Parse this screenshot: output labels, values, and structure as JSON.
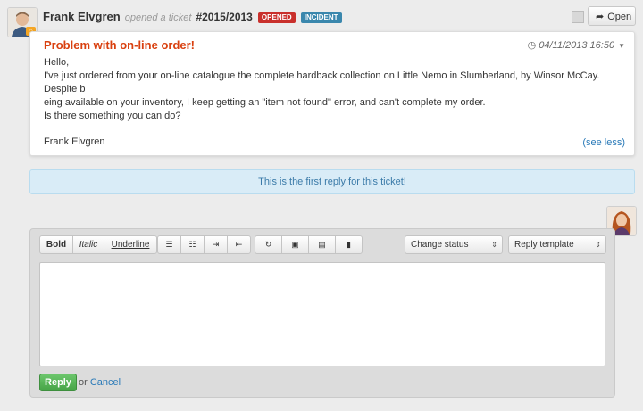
{
  "header": {
    "author": "Frank Elvgren",
    "action": "opened a ticket",
    "ticket_no": "#2015/2013",
    "badge_status": "OPENED",
    "badge_type": "INCIDENT",
    "open_label": "Open"
  },
  "message": {
    "subject": "Problem with on-line order!",
    "date": "04/11/2013 16:50",
    "body": [
      "Hello,",
      "I've just ordered from your on-line catalogue the complete hardback collection on Little Nemo in Slumberland, by Winsor McCay. Despite b",
      "eing available on your inventory, I keep getting an \"item not found\" error, and can't complete my order.",
      "Is there something you can do?",
      "",
      "Frank Elvgren"
    ],
    "see_less": "(see less)"
  },
  "info": "This is the first reply for this ticket!",
  "reply": {
    "bold": "Bold",
    "italic": "Italic",
    "underline": "Underline",
    "change_status": "Change status",
    "reply_template": "Reply template",
    "reply_btn": "Reply",
    "or": "or",
    "cancel": "Cancel"
  },
  "colors": {
    "subject": "#d9400f",
    "badge_opened": "#c9302c",
    "badge_incident": "#3a87ad",
    "info_bg": "#d9ecf7",
    "reply_btn": "#47a447",
    "link": "#2a7ab8"
  },
  "icons": [
    "user-home-icon",
    "share-arrow-icon",
    "clock-icon",
    "caret-down-icon",
    "list-ul-icon",
    "list-ol-icon",
    "indent-icon",
    "outdent-icon",
    "refresh-icon",
    "image-icon",
    "film-icon",
    "file-icon"
  ]
}
